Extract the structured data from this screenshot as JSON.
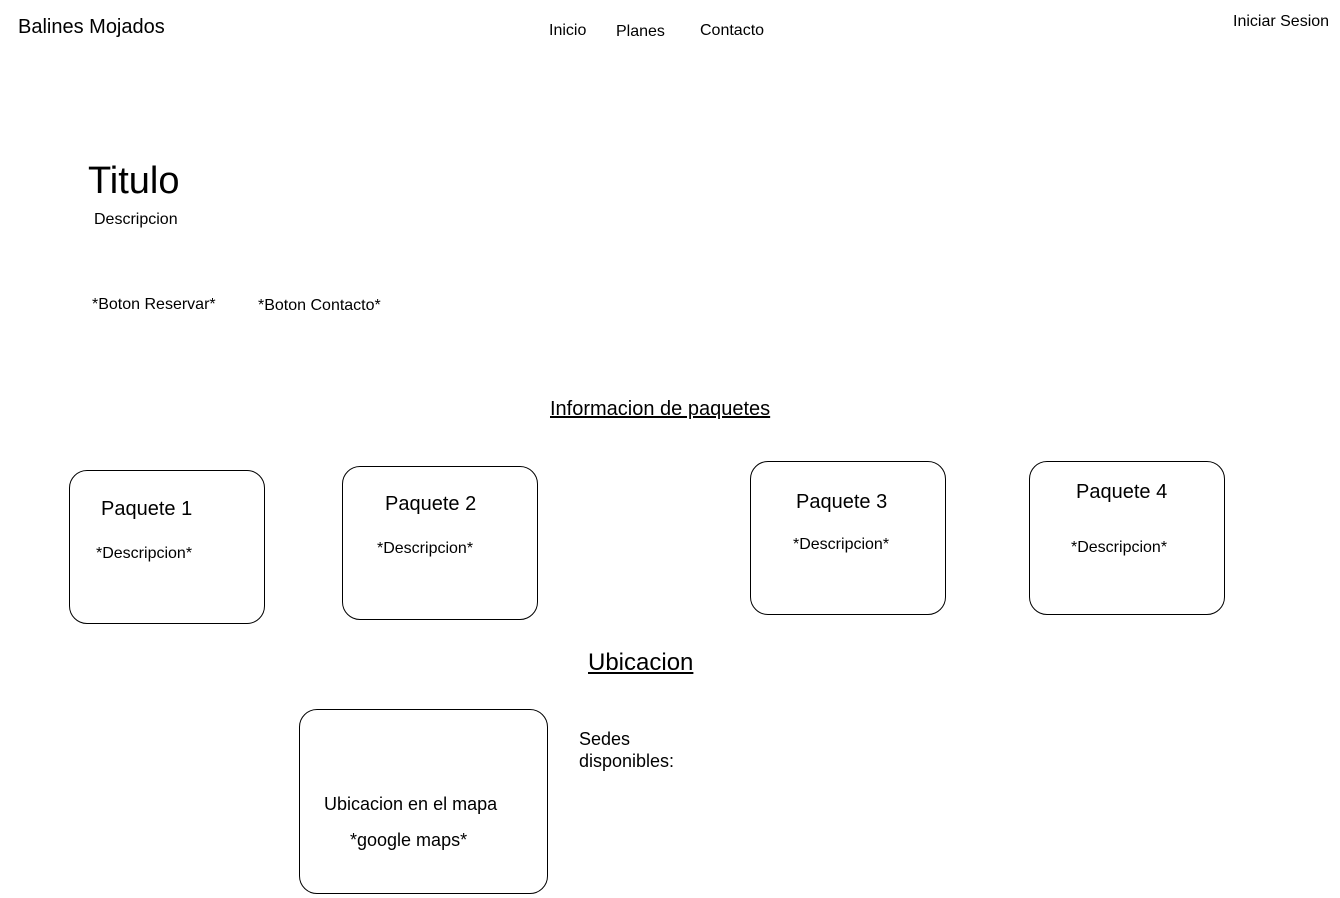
{
  "header": {
    "brand": "Balines Mojados",
    "nav": [
      {
        "label": "Inicio"
      },
      {
        "label": "Planes"
      },
      {
        "label": "Contacto"
      }
    ],
    "login_label": "Iniciar Sesion"
  },
  "hero": {
    "title": "Titulo",
    "description": "Descripcion",
    "reserve_button": "*Boton Reservar*",
    "contact_button": "*Boton Contacto*"
  },
  "packages": {
    "section_title": "Informacion de paquetes",
    "items": [
      {
        "title": "Paquete 1",
        "description": "*Descripcion*"
      },
      {
        "title": "Paquete 2",
        "description": "*Descripcion*"
      },
      {
        "title": "Paquete 3",
        "description": "*Descripcion*"
      },
      {
        "title": "Paquete 4",
        "description": "*Descripcion*"
      }
    ]
  },
  "location": {
    "section_title": "Ubicacion",
    "map_label": "Ubicacion en el mapa",
    "map_note": "*google maps*",
    "branches_label": "Sedes disponibles:"
  }
}
